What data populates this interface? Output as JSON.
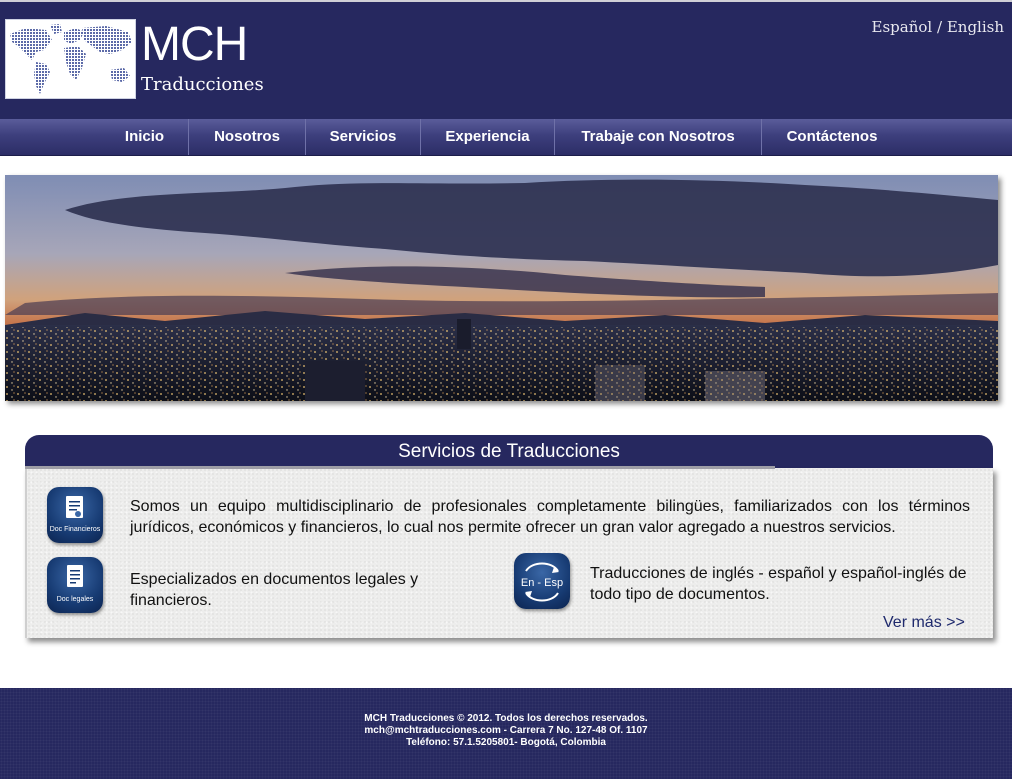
{
  "brand": {
    "name": "MCH",
    "subtitle": "Traducciones"
  },
  "language": {
    "es": "Español",
    "separator": "/",
    "en": "English"
  },
  "nav": {
    "items": [
      {
        "label": "Inicio"
      },
      {
        "label": "Nosotros"
      },
      {
        "label": "Servicios"
      },
      {
        "label": "Experiencia"
      },
      {
        "label": "Trabaje con Nosotros"
      },
      {
        "label": "Contáctenos"
      }
    ]
  },
  "services": {
    "title": "Servicios de Traducciones",
    "intro": "Somos un equipo multidisciplinario de profesionales completamente bilingües, familiarizados con los términos jurídicos, económicos y financieros, lo cual nos permite ofrecer un gran valor agregado a nuestros servicios.",
    "legal": "Especializados en documentos legales y financieros.",
    "translation": "Traducciones de inglés - español y español-inglés de todo tipo de documentos.",
    "more_link": "Ver más >>",
    "icons": {
      "financial_label": "Doc Financieros",
      "legal_label": "Doc legales",
      "lang_label": "En - Esp"
    }
  },
  "footer": {
    "line1": "MCH Traducciones © 2012. Todos los derechos reservados.",
    "line2": "mch@mchtraducciones.com - Carrera 7 No. 127-48 Of. 1107",
    "line3": "Teléfono: 57.1.5205801- Bogotá, Colombia"
  },
  "colors": {
    "brand_navy": "#26285f",
    "nav_gradient_top": "#5a5c9a",
    "icon_blue": "#173b73",
    "link_color": "#1f2a6d"
  },
  "icon_names": [
    "world-map-logo",
    "document-icon",
    "exchange-icon"
  ]
}
